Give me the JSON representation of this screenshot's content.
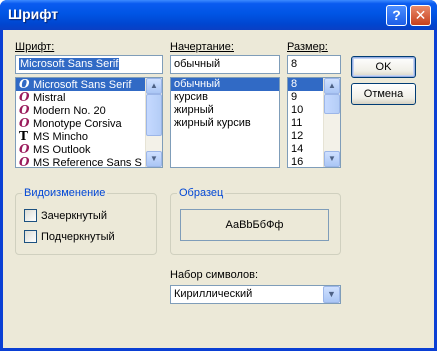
{
  "window": {
    "title": "Шрифт",
    "help_glyph": "?",
    "close_glyph": "✕"
  },
  "font": {
    "label": "Шрифт:",
    "value": "Microsoft Sans Serif",
    "items": [
      {
        "icon": "O",
        "icon_type": "opentype",
        "name": "Microsoft Sans Serif",
        "selected": true
      },
      {
        "icon": "O",
        "icon_type": "opentype",
        "name": "Mistral"
      },
      {
        "icon": "O",
        "icon_type": "opentype",
        "name": "Modern No. 20"
      },
      {
        "icon": "O",
        "icon_type": "opentype",
        "name": "Monotype Corsiva"
      },
      {
        "icon": "T",
        "icon_type": "truetype",
        "name": "MS Mincho"
      },
      {
        "icon": "O",
        "icon_type": "opentype",
        "name": "MS Outlook"
      },
      {
        "icon": "O",
        "icon_type": "opentype",
        "name": "MS Reference Sans S"
      }
    ]
  },
  "style": {
    "label": "Начертание:",
    "value": "обычный",
    "items": [
      "обычный",
      "курсив",
      "жирный",
      "жирный курсив"
    ]
  },
  "size": {
    "label": "Размер:",
    "value": "8",
    "items": [
      "8",
      "9",
      "10",
      "11",
      "12",
      "14",
      "16"
    ]
  },
  "buttons": {
    "ok": "OK",
    "cancel": "Отмена"
  },
  "effects": {
    "title": "Видоизменение",
    "strikeout": "Зачеркнутый",
    "underline": "Подчеркнутый"
  },
  "sample": {
    "title": "Образец",
    "text": "АаBbБбФф"
  },
  "charset": {
    "label": "Набор символов:",
    "value": "Кириллический"
  },
  "colors": {
    "title_bar": "#0055e5",
    "selection": "#316ac5",
    "group_title": "#0046d5",
    "dialog_face": "#ece9d8"
  }
}
